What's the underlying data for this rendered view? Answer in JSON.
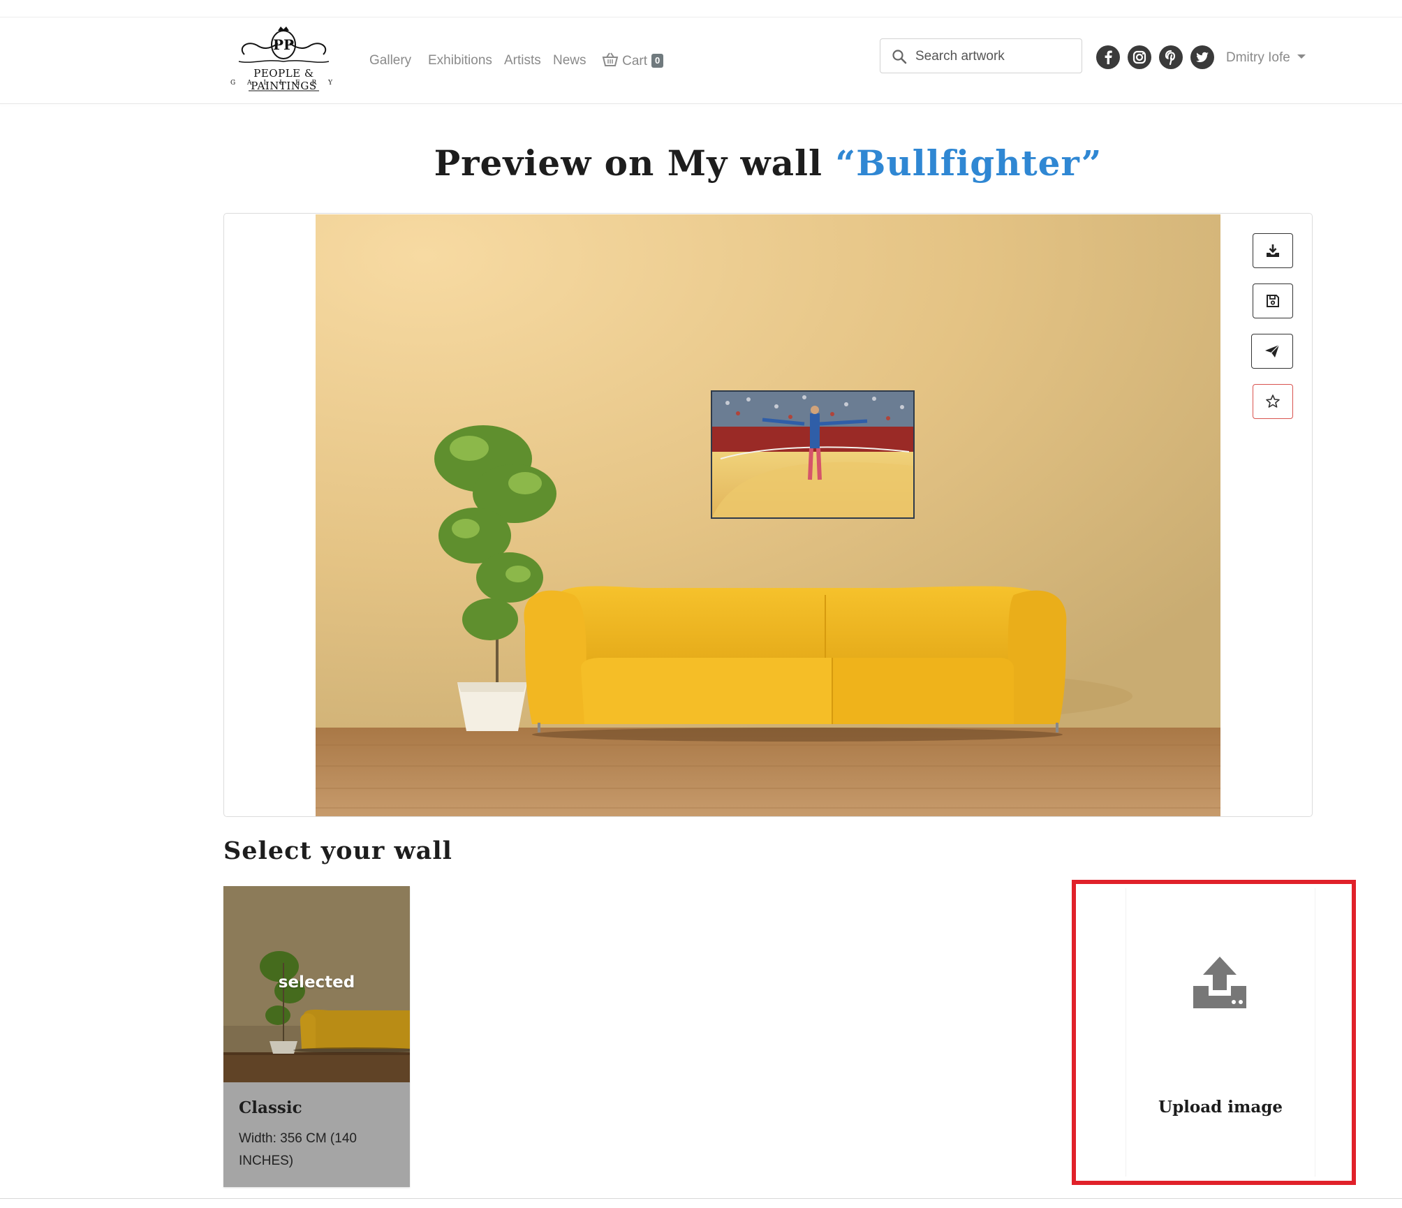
{
  "brand": {
    "name": "People & Paintings",
    "sub": "G A L L E R Y",
    "monogram": "PP"
  },
  "nav": {
    "gallery": "Gallery",
    "exhibitions": "Exhibitions",
    "artists": "Artists",
    "news": "News",
    "cart": "Cart",
    "cart_count": "0"
  },
  "search": {
    "placeholder": "Search artwork",
    "value": ""
  },
  "social": [
    "facebook-icon",
    "instagram-icon",
    "pinterest-icon",
    "twitter-icon"
  ],
  "user": {
    "name": "Dmitry Iofe"
  },
  "page": {
    "title_prefix": "Preview on My wall ",
    "title_highlight": "“Bullfighter”"
  },
  "toolbar": {
    "download": "download-icon",
    "save": "save-icon",
    "send": "send-icon",
    "favorite": "star-icon"
  },
  "walls": {
    "section_title": "Select your wall",
    "items": [
      {
        "name": "Classic",
        "width": "Width: 356 CM (140 INCHES)",
        "state": "selected"
      }
    ],
    "upload_label": "Upload image"
  },
  "colors": {
    "accent": "#2f87d3",
    "highlight_box": "#e0212a",
    "wall": "#e9c98a",
    "sofa": "#f2b821"
  }
}
